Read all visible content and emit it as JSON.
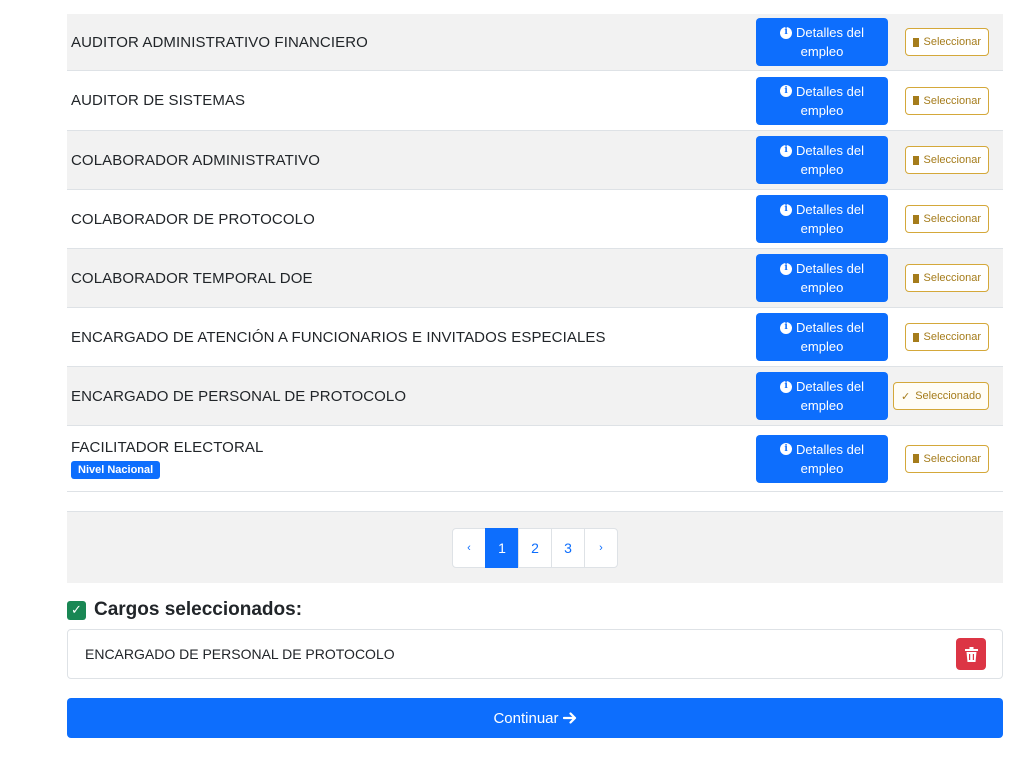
{
  "jobs": [
    {
      "title": "AUDITOR ADMINISTRATIVO FINANCIERO",
      "details_l1": "Detalles del",
      "details_l2": "empleo",
      "select_label": "Seleccionar",
      "state": "unselected"
    },
    {
      "title": "AUDITOR DE SISTEMAS",
      "details_l1": "Detalles del",
      "details_l2": "empleo",
      "select_label": "Seleccionar",
      "state": "unselected"
    },
    {
      "title": "COLABORADOR ADMINISTRATIVO",
      "details_l1": "Detalles del",
      "details_l2": "empleo",
      "select_label": "Seleccionar",
      "state": "unselected"
    },
    {
      "title": "COLABORADOR DE PROTOCOLO",
      "details_l1": "Detalles del",
      "details_l2": "empleo",
      "select_label": "Seleccionar",
      "state": "unselected"
    },
    {
      "title": "COLABORADOR TEMPORAL DOE",
      "details_l1": "Detalles del",
      "details_l2": "empleo",
      "select_label": "Seleccionar",
      "state": "unselected"
    },
    {
      "title": "ENCARGADO DE ATENCIÓN A FUNCIONARIOS E INVITADOS ESPECIALES",
      "details_l1": "Detalles del",
      "details_l2": "empleo",
      "select_label": "Seleccionar",
      "state": "unselected"
    },
    {
      "title": "ENCARGADO DE PERSONAL DE PROTOCOLO",
      "details_l1": "Detalles del",
      "details_l2": "empleo",
      "select_label": "Seleccionado",
      "state": "selected"
    },
    {
      "title": "FACILITADOR ELECTORAL",
      "badge": "Nivel Nacional",
      "details_l1": "Detalles del",
      "details_l2": "empleo",
      "select_label": "Seleccionar",
      "state": "unselected"
    }
  ],
  "pagination": {
    "prev": "‹",
    "pages": [
      "1",
      "2",
      "3"
    ],
    "active_page": "1",
    "next": "›"
  },
  "selected_section": {
    "heading": "Cargos seleccionados:",
    "items": [
      "ENCARGADO DE PERSONAL DE PROTOCOLO"
    ]
  },
  "continue_label": "Continuar",
  "colors": {
    "primary": "#0d6efd",
    "warning_outline": "#d4a83a",
    "danger": "#dc3545",
    "success": "#198754",
    "stripe": "#f2f2f2"
  },
  "icons": {
    "details": "info-circle-icon",
    "select": "square-icon",
    "selected": "check-icon",
    "heading": "check-square-icon",
    "remove": "trash-icon",
    "continue": "arrow-right-icon"
  }
}
